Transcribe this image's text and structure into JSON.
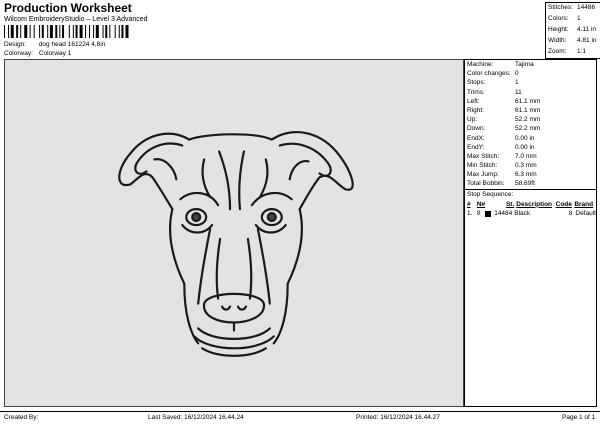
{
  "header": {
    "title": "Production Worksheet",
    "subtitle": "Wilcom EmbroideryStudio – Level 3 Advanced"
  },
  "design_info": {
    "design_label": "Design:",
    "design_value": "dog head 161224 4,8in",
    "colorway_label": "Colorway:",
    "colorway_value": "Colorway 1"
  },
  "top_stats": [
    {
      "label": "Stitches:",
      "value": "14486"
    },
    {
      "label": "Colors:",
      "value": "1"
    },
    {
      "label": "Height:",
      "value": "4.11 in"
    },
    {
      "label": "Width:",
      "value": "4.81 in"
    },
    {
      "label": "Zoom:",
      "value": "1:1"
    }
  ],
  "machine_info": [
    {
      "label": "Machine:",
      "value": "Tajima"
    },
    {
      "label": "Color changes:",
      "value": "0"
    },
    {
      "label": "Stops:",
      "value": "1"
    },
    {
      "label": "Trims:",
      "value": "11"
    },
    {
      "label": "Left:",
      "value": "61.1 mm"
    },
    {
      "label": "Right:",
      "value": "61.1 mm"
    },
    {
      "label": "Up:",
      "value": "52.2 mm"
    },
    {
      "label": "Down:",
      "value": "52.2 mm"
    },
    {
      "label": "EndX:",
      "value": "0.00 in"
    },
    {
      "label": "EndY:",
      "value": "0.00 in"
    },
    {
      "label": "Max Stitch:",
      "value": "7.0 mm"
    },
    {
      "label": "Min Stitch:",
      "value": "0.3 mm"
    },
    {
      "label": "Max Jump:",
      "value": "6.3 mm"
    },
    {
      "label": "Total Bobbin:",
      "value": "58.69ft"
    }
  ],
  "stop_sequence": {
    "title": "Stop Sequence:",
    "columns": [
      "#",
      "N#",
      "St.",
      "Description",
      "Code",
      "Brand"
    ],
    "rows": [
      {
        "index": "1.",
        "needle": "8",
        "color": "#000000",
        "stitches": "14484",
        "description": "Black",
        "code": "8",
        "brand": "Default"
      }
    ]
  },
  "footer": {
    "created_by": "Created By:",
    "last_saved": "Last Saved: 16/12/2024 16.44.24",
    "printed": "Printed: 16/12/2024 16.44.27",
    "page": "Page 1 of 1"
  }
}
